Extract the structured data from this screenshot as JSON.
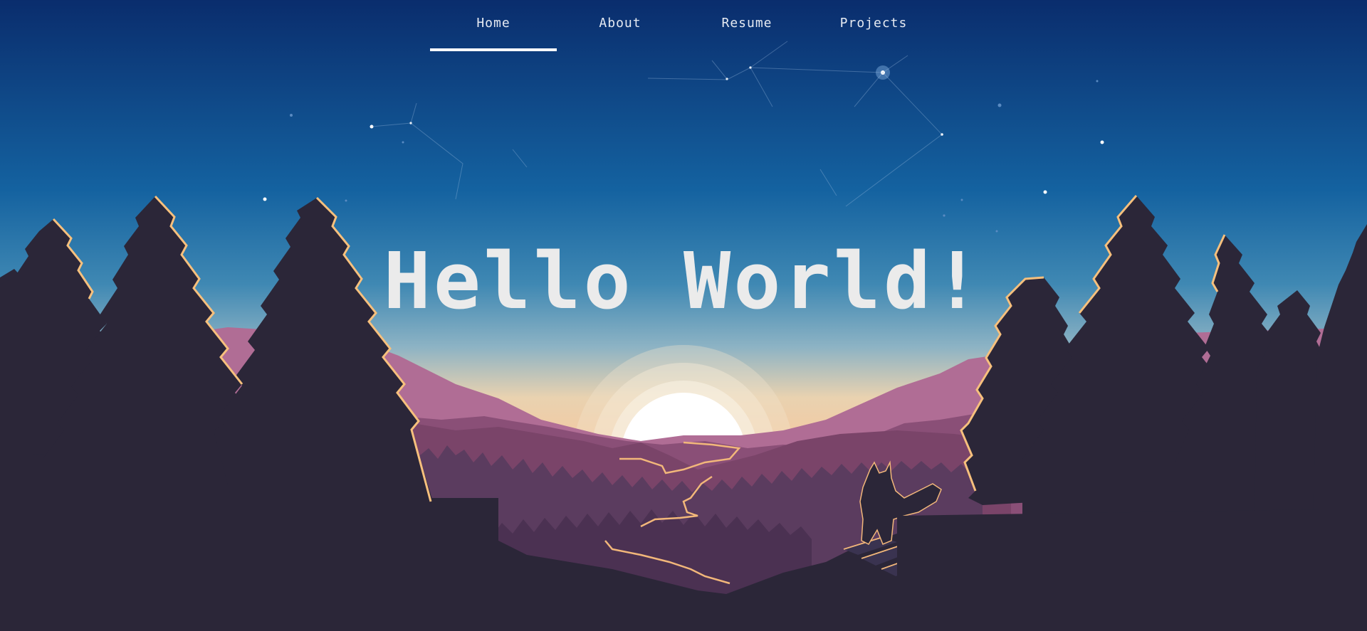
{
  "nav": {
    "items": [
      {
        "label": "Home",
        "active": true
      },
      {
        "label": "About",
        "active": false
      },
      {
        "label": "Resume",
        "active": false
      },
      {
        "label": "Projects",
        "active": false
      }
    ]
  },
  "hero": {
    "title": "Hello World!"
  },
  "colors": {
    "sky_top": "#0a2e6e",
    "sky_mid": "#1462a0",
    "horizon": "#f1d4a6",
    "mountain_far": "#b06d95",
    "mountain_mid": "#824d73",
    "forest": "#5a3a5e",
    "foreground": "#2b2638",
    "tree_highlight": "#f7c07d",
    "text": "#ebebeb"
  },
  "icons": {
    "scene": "night-landscape-illustration",
    "animal": "fox-silhouette"
  }
}
